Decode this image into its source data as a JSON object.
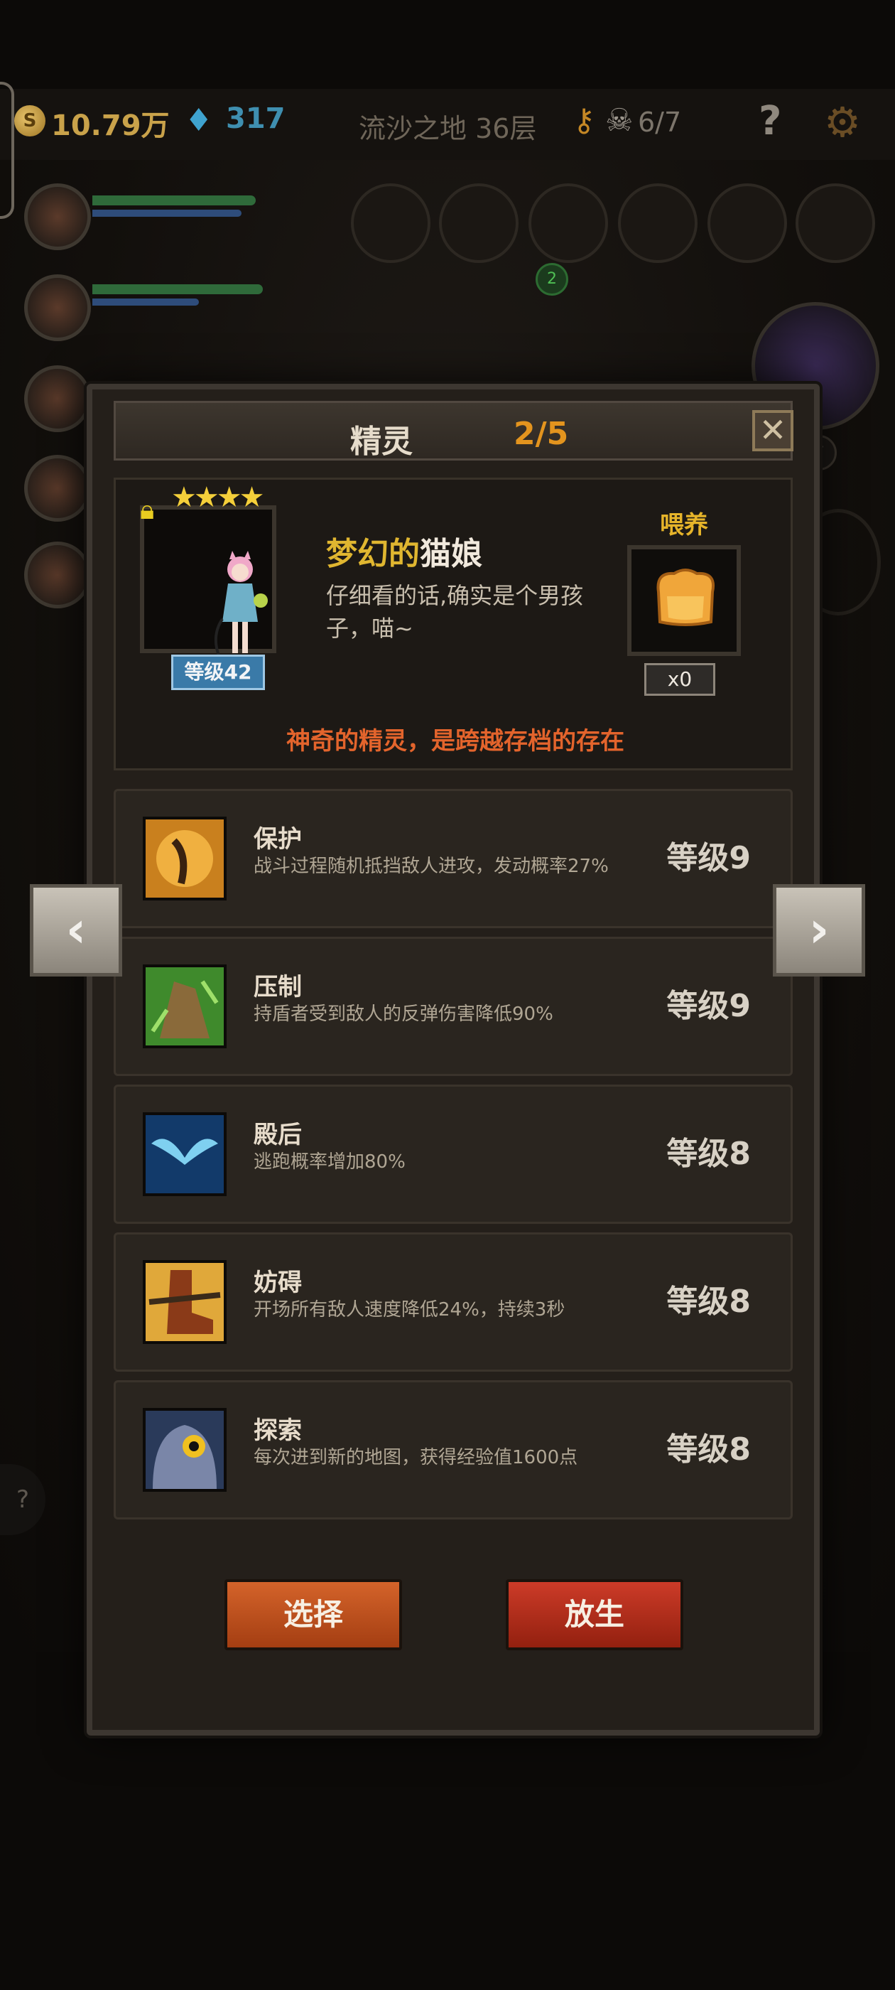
{
  "hud": {
    "gold_coin_letter": "S",
    "gold": "10.79万",
    "gems": "317",
    "floor": "流沙之地 36层",
    "kills": "6/7",
    "help": "?",
    "slot_badge": "2",
    "boss_count": "7",
    "bottom_help": "?"
  },
  "dialog": {
    "title": "精灵",
    "count": "2/5",
    "close": "✕",
    "spirit": {
      "stars": "★★★★",
      "level": "等级42",
      "name_part1": "梦幻的",
      "name_part2": "猫娘",
      "description": "仔细看的话,确实是个男孩子，喵~",
      "feed_label": "喂养",
      "feed_count": "x0",
      "tagline": "神奇的精灵，是跨越存档的存在"
    },
    "skills": [
      {
        "name": "保护",
        "description": "战斗过程随机抵挡敌人进攻，发动概率27%",
        "level": "等级9",
        "icon": "shield-guardian-icon"
      },
      {
        "name": "压制",
        "description": "持盾者受到敌人的反弹伤害降低90%",
        "level": "等级9",
        "icon": "claw-icon"
      },
      {
        "name": "殿后",
        "description": "逃跑概率增加80%",
        "level": "等级8",
        "icon": "wings-icon"
      },
      {
        "name": "妨碍",
        "description": "开场所有敌人速度降低24%，持续3秒",
        "level": "等级8",
        "icon": "chained-boot-icon"
      },
      {
        "name": "探索",
        "description": "每次进到新的地图，获得经验值1600点",
        "level": "等级8",
        "icon": "owl-icon"
      }
    ],
    "buttons": {
      "select": "选择",
      "release": "放生"
    }
  },
  "nav": {
    "prev": "‹",
    "next": "›"
  },
  "colors": {
    "accent_orange": "#e3941e",
    "tagline_red": "#e3642c",
    "name_gold": "#e0b630",
    "select_button": "#c55320",
    "release_button": "#b12f1c"
  }
}
